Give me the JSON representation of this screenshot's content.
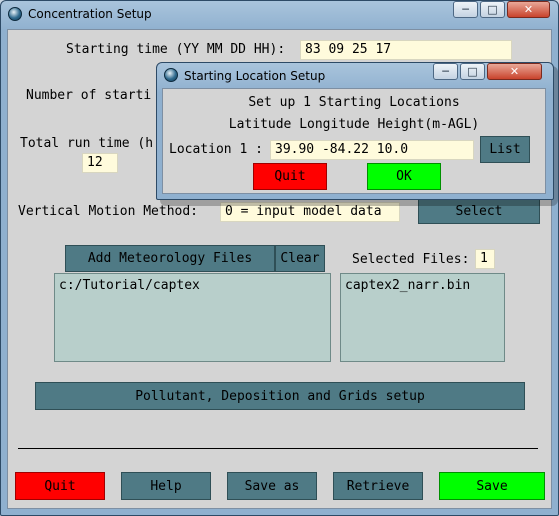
{
  "main_window": {
    "title": "Concentration Setup",
    "starting_time_label": "Starting time (YY MM DD HH):",
    "starting_time_value": "83 09 25 17",
    "num_locations_label": "Number of starti",
    "run_time_label": "Total run time (h",
    "run_time_value": "12",
    "vertical_motion_label": "Vertical Motion Method:",
    "vertical_motion_value": "0 = input model data",
    "select_label": "Select",
    "add_met_label": "Add Meteorology Files",
    "clear_label": "Clear",
    "selected_files_label": "Selected Files:",
    "selected_files_count": "1",
    "dir_list": [
      "c:/Tutorial/captex"
    ],
    "file_list": [
      "captex2_narr.bin"
    ],
    "pollutant_label": "Pollutant, Deposition and Grids setup",
    "quit_label": "Quit",
    "help_label": "Help",
    "save_as_label": "Save as",
    "retrieve_label": "Retrieve",
    "save_label": "Save"
  },
  "dialog": {
    "title": "Starting Location Setup",
    "heading": "Set up 1 Starting Locations",
    "subheading": "Latitude Longitude Height(m-AGL)",
    "location_label": "Location 1 :",
    "location_value": "39.90 -84.22 10.0",
    "list_label": "List",
    "quit_label": "Quit",
    "ok_label": "OK"
  },
  "icons": {
    "app": "app-globe-icon",
    "minimize": "minimize-icon",
    "maximize": "maximize-icon",
    "close": "close-icon"
  },
  "colors": {
    "quit": "#ff0000",
    "ok": "#00ff00",
    "button_teal": "#4f7a85",
    "field_bg": "#fffbdc",
    "list_bg": "#b8cfcb"
  }
}
